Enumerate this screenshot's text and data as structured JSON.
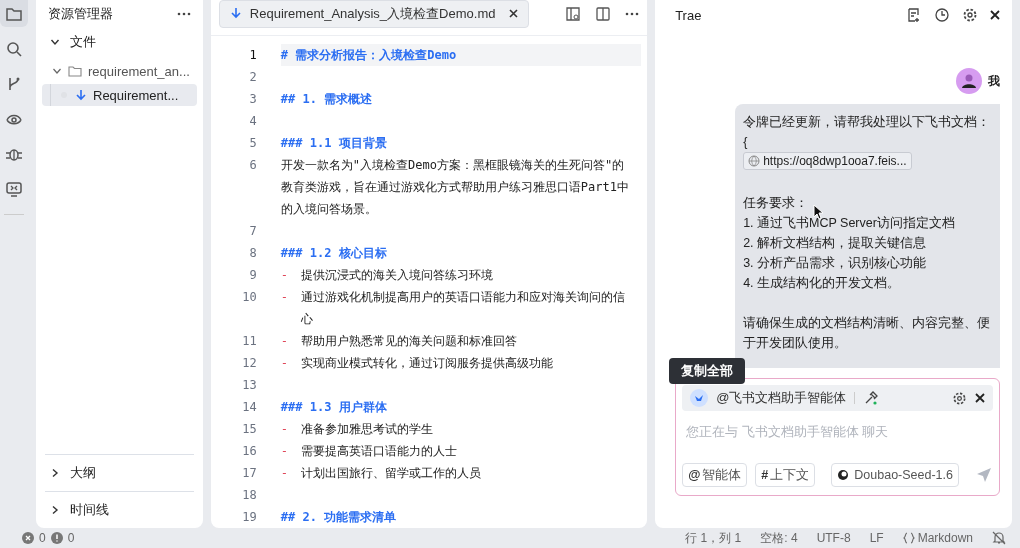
{
  "activity_bar": {
    "items": [
      {
        "selected": true
      },
      {
        "selected": false
      },
      {
        "selected": false
      },
      {
        "selected": false
      },
      {
        "selected": false
      },
      {
        "selected": false
      }
    ]
  },
  "explorer": {
    "title": "资源管理器",
    "section": {
      "label": "文件",
      "expanded": true
    },
    "tree": [
      {
        "label": "requirement_an...",
        "kind": "folder",
        "expanded": true,
        "selected": false,
        "children": [
          {
            "label": "Requirement...",
            "kind": "file",
            "selected": true
          }
        ]
      }
    ],
    "bottom_sections": [
      {
        "label": "大纲",
        "expanded": false
      },
      {
        "label": "时间线",
        "expanded": false
      }
    ]
  },
  "editor": {
    "tab": {
      "label": "Requirement_Analysis_入境检查Demo.md",
      "selected": true
    },
    "lines": [
      {
        "number": "1",
        "kind": "heading",
        "text": "# 需求分析报告：入境检查Demo",
        "current": true
      },
      {
        "number": "2",
        "kind": "blank",
        "current": false
      },
      {
        "number": "3",
        "kind": "heading",
        "text": "## 1. 需求概述",
        "current": false
      },
      {
        "number": "4",
        "kind": "blank",
        "current": false
      },
      {
        "number": "5",
        "kind": "heading",
        "text": "### 1.1 项目背景",
        "current": false
      },
      {
        "number": "6",
        "kind": "text",
        "text": "开发一款名为\"入境检查Demo方案：黑框眼镜海关的生死问答\"的教育类游戏，旨在通过游戏化方式帮助用户练习雅思口语Part1中的入境问答场景。",
        "current": false
      },
      {
        "number": "7",
        "kind": "blank",
        "current": false
      },
      {
        "number": "8",
        "kind": "heading",
        "text": "### 1.2 核心目标",
        "current": false
      },
      {
        "number": "9",
        "kind": "bullet",
        "marker": "-",
        "text": "提供沉浸式的海关入境问答练习环境",
        "current": false
      },
      {
        "number": "10",
        "kind": "bullet",
        "marker": "-",
        "text": "通过游戏化机制提高用户的英语口语能力和应对海关询问的信心",
        "current": false
      },
      {
        "number": "11",
        "kind": "bullet",
        "marker": "-",
        "text": "帮助用户熟悉常见的海关问题和标准回答",
        "current": false
      },
      {
        "number": "12",
        "kind": "bullet",
        "marker": "-",
        "text": "实现商业模式转化，通过订阅服务提供高级功能",
        "current": false
      },
      {
        "number": "13",
        "kind": "blank",
        "current": false
      },
      {
        "number": "14",
        "kind": "heading",
        "text": "### 1.3 用户群体",
        "current": false
      },
      {
        "number": "15",
        "kind": "bullet",
        "marker": "-",
        "text": "准备参加雅思考试的学生",
        "current": false
      },
      {
        "number": "16",
        "kind": "bullet",
        "marker": "-",
        "text": "需要提高英语口语能力的人士",
        "current": false
      },
      {
        "number": "17",
        "kind": "bullet",
        "marker": "-",
        "text": "计划出国旅行、留学或工作的人员",
        "current": false
      },
      {
        "number": "18",
        "kind": "blank",
        "current": false
      },
      {
        "number": "19",
        "kind": "heading",
        "text": "## 2. 功能需求清单",
        "current": false
      }
    ]
  },
  "chat": {
    "title": "Trae",
    "user": {
      "name": "我"
    },
    "message": [
      {
        "kind": "text",
        "text": "令牌已经更新，请帮我处理以下飞书文档："
      },
      {
        "kind": "text",
        "text": "{"
      },
      {
        "kind": "link",
        "text": "https://oq8dwp1ooa7.feis..."
      },
      {
        "kind": "blank"
      },
      {
        "kind": "text",
        "text": "任务要求："
      },
      {
        "kind": "text",
        "text": "1. 通过飞书MCP Server访问指定文档"
      },
      {
        "kind": "text",
        "text": "2. 解析文档结构，提取关键信息"
      },
      {
        "kind": "text",
        "text": "3. 分析产品需求，识别核心功能"
      },
      {
        "kind": "text",
        "text": "4. 生成结构化的开发文档。"
      },
      {
        "kind": "blank"
      },
      {
        "kind": "text",
        "text": "请确保生成的文档结构清晰、内容完整、便于开发团队使用。"
      }
    ],
    "tooltip": "复制全部",
    "agent_chip": "@飞书文档助手智能体",
    "input": {
      "placeholder": "您正在与 飞书文档助手智能体 聊天"
    },
    "buttons": [
      {
        "icon": "@",
        "label": "智能体"
      },
      {
        "icon": "#",
        "label": "上下文"
      }
    ],
    "model": "Doubao-Seed-1.6"
  },
  "status_bar": {
    "errors": "0",
    "warnings": "0",
    "items": [
      "行 1，列 1",
      "空格: 4",
      "UTF-8",
      "LF",
      "Markdown"
    ]
  }
}
